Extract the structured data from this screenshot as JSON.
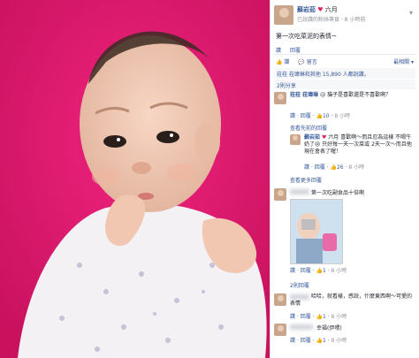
{
  "post": {
    "author": "蘇岩茹",
    "author_suffix": "六月",
    "author_suffix_emoji": "♥",
    "meta_a": "已說讚的粉絲專頁",
    "meta_time": "8 小時前",
    "caption": "第一次吃菜泥的表情~"
  },
  "post_actions": [
    "讚",
    "回覆"
  ],
  "reactions": {
    "like_label": "讚",
    "comment_label": "留言",
    "sort_label": "最相關",
    "summary": "菈菈 菈瑋琳和其他 15,890 人都說讚。",
    "shares": "2則分享"
  },
  "comments": [
    {
      "name": "菈菈 菈瑋琳",
      "text": "😥 貓子是喜歡還是不喜歡啊？",
      "actions": [
        "讚",
        "回覆"
      ],
      "likes": "10",
      "time": "8 小時"
    }
  ],
  "reply_link": "查看先前的回覆",
  "reply": {
    "name": "蘇岩茹",
    "suffix": "六月",
    "text": "喜歡啊～而且忍為這樣 不喝牛奶了😢 只好每一天一次菜或 2天一次～而且他現在會表了喔！",
    "actions": [
      "讚",
      "回覆"
    ],
    "likes": "26",
    "time": "8 小時"
  },
  "more_replies": "查看更多回覆",
  "comment2": {
    "text": "第一次吃副食品十倍啊",
    "actions": [
      "讚",
      "回覆"
    ],
    "likes": "1",
    "time": "8 小時"
  },
  "reply_count": "2則回覆",
  "comment3": {
    "text": "哈哈，就看樣，感說，什麼東西啊～可愛的表情",
    "actions": [
      "讚",
      "回覆"
    ],
    "likes": "1",
    "time": "8 小時"
  },
  "comment4": {
    "text": "幸福(伊喂)",
    "actions": [
      "讚",
      "回覆"
    ],
    "likes": "1",
    "time": "8 小時"
  },
  "icons": {
    "chevron": "chevron-down-icon",
    "like": "like-icon",
    "comment": "comment-icon"
  }
}
